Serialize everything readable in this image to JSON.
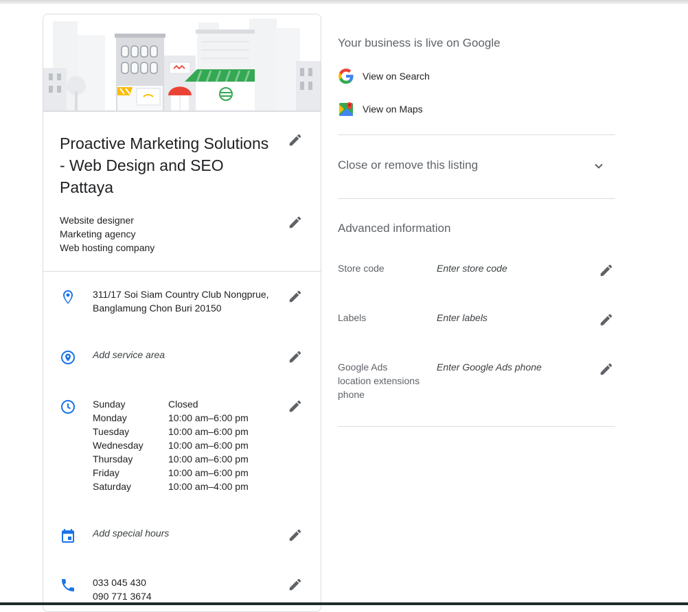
{
  "business": {
    "name": "Proactive Marketing Solutions - Web Design and SEO Pattaya",
    "categories": [
      "Website designer",
      "Marketing agency",
      "Web hosting company"
    ],
    "address_line1": "311/17 Soi Siam Country Club Nongprue,",
    "address_line2": "Banglamung Chon Buri 20150",
    "service_area": "Add service area",
    "hours": [
      {
        "day": "Sunday",
        "time": "Closed"
      },
      {
        "day": "Monday",
        "time": "10:00 am–6:00 pm"
      },
      {
        "day": "Tuesday",
        "time": "10:00 am–6:00 pm"
      },
      {
        "day": "Wednesday",
        "time": "10:00 am–6:00 pm"
      },
      {
        "day": "Thursday",
        "time": "10:00 am–6:00 pm"
      },
      {
        "day": "Friday",
        "time": "10:00 am–6:00 pm"
      },
      {
        "day": "Saturday",
        "time": "10:00 am–4:00 pm"
      }
    ],
    "special_hours": "Add special hours",
    "phones": [
      "033 045 430",
      "090 771 3674"
    ]
  },
  "right": {
    "live_title": "Your business is live on Google",
    "view_search": "View on Search",
    "view_maps": "View on Maps",
    "close_listing": "Close or remove this listing",
    "advanced_title": "Advanced information",
    "fields": [
      {
        "label": "Store code",
        "value": "Enter store code"
      },
      {
        "label": "Labels",
        "value": "Enter labels"
      },
      {
        "label": "Google Ads location extensions phone",
        "value": "Enter Google Ads phone"
      }
    ]
  },
  "icons": {
    "edit": "pencil-icon",
    "address": "location-pin-icon",
    "service_area": "service-area-icon",
    "hours": "clock-icon",
    "special_hours": "calendar-icon",
    "phone": "phone-icon",
    "search": "google-g-icon",
    "maps": "google-maps-icon",
    "expand": "chevron-down-icon"
  },
  "colors": {
    "accent_blue": "#1a73e8",
    "text": "#202124",
    "secondary_text": "#5f6368",
    "divider": "#dadce0",
    "storefront_green": "#34a853",
    "awning_red": "#ea4335",
    "awning_yellow": "#fbbc04"
  }
}
